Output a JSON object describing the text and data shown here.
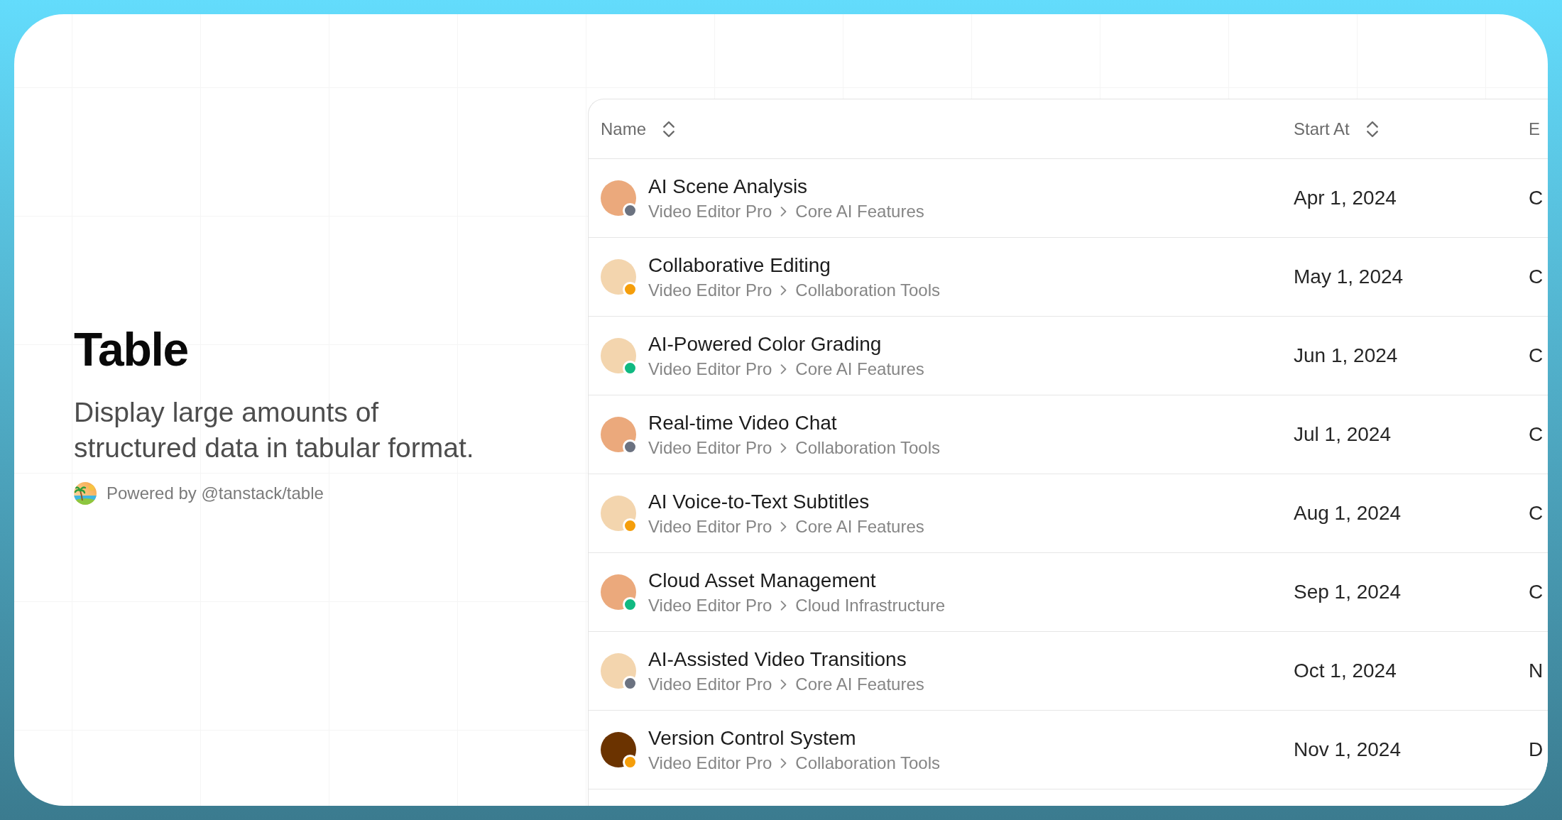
{
  "intro": {
    "title": "Table",
    "description": "Display large amounts of structured data in tabular format.",
    "credit": "Powered by @tanstack/table"
  },
  "table": {
    "columns": [
      {
        "label": "Name",
        "sortable": true
      },
      {
        "label": "Start At",
        "sortable": true
      },
      {
        "label": "E",
        "sortable": false
      }
    ],
    "rows": [
      {
        "name": "AI Scene Analysis",
        "path": [
          "Video Editor Pro",
          "Core AI Features"
        ],
        "avatar": {
          "color": "#eba97c"
        },
        "status": {
          "color": "#6b7280"
        },
        "start_at": "Apr 1, 2024",
        "column_3": "C"
      },
      {
        "name": "Collaborative Editing",
        "path": [
          "Video Editor Pro",
          "Collaboration Tools"
        ],
        "avatar": {
          "color": "#f3d5ae"
        },
        "status": {
          "color": "#f59e0b"
        },
        "start_at": "May 1, 2024",
        "column_3": "C"
      },
      {
        "name": "AI-Powered Color Grading",
        "path": [
          "Video Editor Pro",
          "Core AI Features"
        ],
        "avatar": {
          "color": "#f3d5ae"
        },
        "status": {
          "color": "#10b981"
        },
        "start_at": "Jun 1, 2024",
        "column_3": "C"
      },
      {
        "name": "Real-time Video Chat",
        "path": [
          "Video Editor Pro",
          "Collaboration Tools"
        ],
        "avatar": {
          "color": "#eba97c"
        },
        "status": {
          "color": "#6b7280"
        },
        "start_at": "Jul 1, 2024",
        "column_3": "C"
      },
      {
        "name": "AI Voice-to-Text Subtitles",
        "path": [
          "Video Editor Pro",
          "Core AI Features"
        ],
        "avatar": {
          "color": "#f3d5ae"
        },
        "status": {
          "color": "#f59e0b"
        },
        "start_at": "Aug 1, 2024",
        "column_3": "C"
      },
      {
        "name": "Cloud Asset Management",
        "path": [
          "Video Editor Pro",
          "Cloud Infrastructure"
        ],
        "avatar": {
          "color": "#eba97c"
        },
        "status": {
          "color": "#10b981"
        },
        "start_at": "Sep 1, 2024",
        "column_3": "C"
      },
      {
        "name": "AI-Assisted Video Transitions",
        "path": [
          "Video Editor Pro",
          "Core AI Features"
        ],
        "avatar": {
          "color": "#f3d5ae"
        },
        "status": {
          "color": "#6b7280"
        },
        "start_at": "Oct 1, 2024",
        "column_3": "N"
      },
      {
        "name": "Version Control System",
        "path": [
          "Video Editor Pro",
          "Collaboration Tools"
        ],
        "avatar": {
          "color": "#6b3300"
        },
        "status": {
          "color": "#f59e0b"
        },
        "start_at": "Nov 1, 2024",
        "column_3": "D"
      }
    ]
  }
}
